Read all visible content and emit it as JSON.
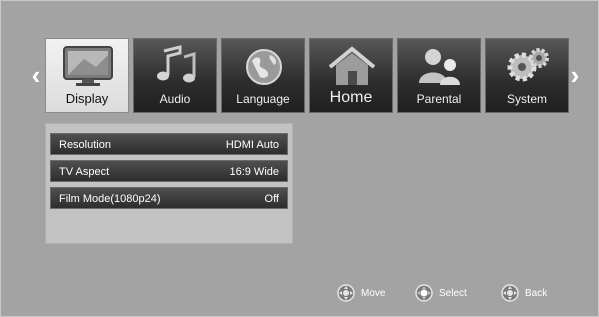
{
  "nav": {
    "prev_glyph": "‹",
    "next_glyph": "›"
  },
  "tabs": [
    {
      "label": "Display",
      "icon": "tv-icon",
      "active": true
    },
    {
      "label": "Audio",
      "icon": "music-notes-icon",
      "active": false
    },
    {
      "label": "Language",
      "icon": "globe-icon",
      "active": false
    },
    {
      "label": "Home",
      "icon": "home-icon",
      "active": false
    },
    {
      "label": "Parental",
      "icon": "parental-icon",
      "active": false
    },
    {
      "label": "System",
      "icon": "gears-icon",
      "active": false
    }
  ],
  "settings": [
    {
      "key": "Resolution",
      "value": "HDMI Auto"
    },
    {
      "key": "TV Aspect",
      "value": "16:9 Wide"
    },
    {
      "key": "Film Mode(1080p24)",
      "value": "Off"
    }
  ],
  "hints": [
    {
      "label": "Move",
      "icon": "dpad-move-icon"
    },
    {
      "label": "Select",
      "icon": "dpad-select-icon"
    },
    {
      "label": "Back",
      "icon": "dpad-back-icon"
    }
  ]
}
